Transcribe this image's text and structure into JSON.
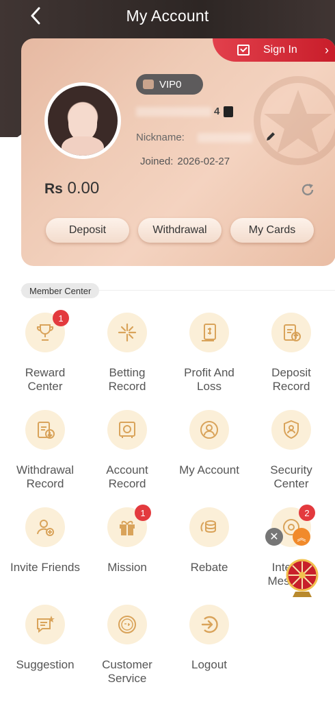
{
  "header": {
    "title": "My Account"
  },
  "card": {
    "signin_label": "Sign In",
    "vip_label": "VIP0",
    "uid_tail": "4",
    "nickname_label": "Nickname:",
    "joined_label": "Joined:",
    "joined_date": "2026-02-27",
    "currency": "Rs",
    "balance": "0.00",
    "buttons": {
      "deposit": "Deposit",
      "withdrawal": "Withdrawal",
      "my_cards": "My Cards"
    }
  },
  "member_center": {
    "title": "Member Center",
    "items": [
      {
        "label": "Reward Center",
        "icon": "trophy-icon",
        "badge": "1"
      },
      {
        "label": "Betting Record",
        "icon": "sparkle-icon"
      },
      {
        "label": "Profit And Loss",
        "icon": "dollar-document-icon"
      },
      {
        "label": "Deposit Record",
        "icon": "clipboard-upload-icon"
      },
      {
        "label": "Withdrawal Record",
        "icon": "clipboard-download-icon"
      },
      {
        "label": "Account Record",
        "icon": "safe-icon"
      },
      {
        "label": "My Account",
        "icon": "user-icon"
      },
      {
        "label": "Security Center",
        "icon": "shield-user-icon"
      },
      {
        "label": "Invite Friends",
        "icon": "add-user-icon"
      },
      {
        "label": "Mission",
        "icon": "gift-icon",
        "badge": "1"
      },
      {
        "label": "Rebate",
        "icon": "coins-icon"
      },
      {
        "label": "Internal Message",
        "icon": "message-icon",
        "badge": "2"
      },
      {
        "label": "Suggestion",
        "icon": "feedback-icon"
      },
      {
        "label": "Customer Service",
        "icon": "support-24-7-icon"
      },
      {
        "label": "Logout",
        "icon": "logout-icon"
      }
    ]
  },
  "colors": {
    "accent_red": "#e33a3e",
    "icon_bg": "#fbefd8",
    "icon_fg": "#d9a35a",
    "header_dark": "#2d2624"
  }
}
